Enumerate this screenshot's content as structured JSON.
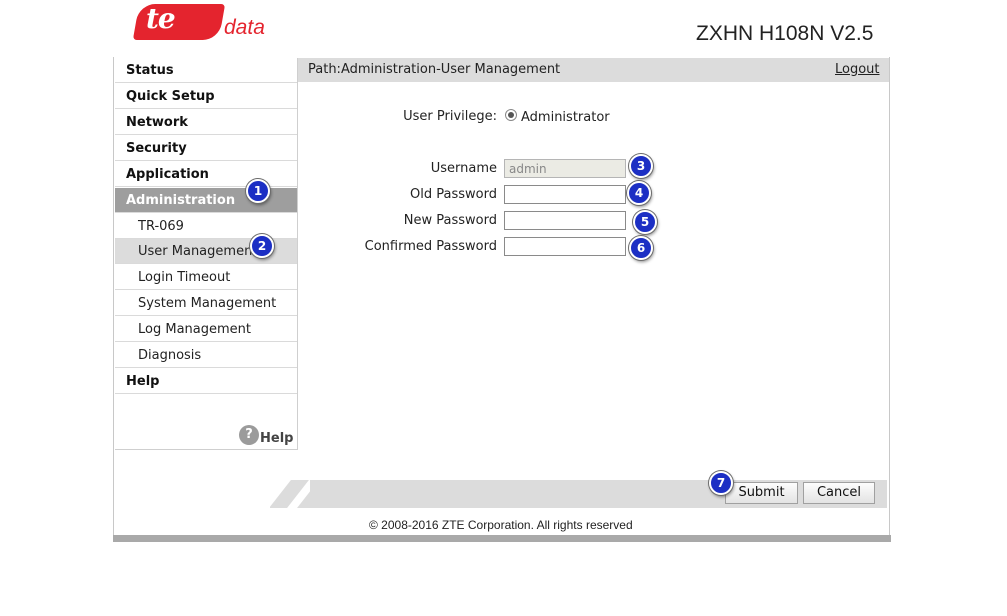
{
  "brand": {
    "logo_text": "te",
    "logo_suffix": "data",
    "model": "ZXHN H108N V2.5"
  },
  "sidebar": {
    "items": [
      {
        "label": "Status"
      },
      {
        "label": "Quick Setup"
      },
      {
        "label": "Network"
      },
      {
        "label": "Security"
      },
      {
        "label": "Application"
      },
      {
        "label": "Administration"
      },
      {
        "label": "TR-069"
      },
      {
        "label": "User Management"
      },
      {
        "label": "Login Timeout"
      },
      {
        "label": "System Management"
      },
      {
        "label": "Log Management"
      },
      {
        "label": "Diagnosis"
      },
      {
        "label": "Help"
      }
    ],
    "help_glyph": "?",
    "help_label": "Help"
  },
  "header": {
    "path": "Path:Administration-User Management",
    "logout": "Logout"
  },
  "form": {
    "privilege_label": "User Privilege:",
    "privilege_value": "Administrator",
    "username_label": "Username",
    "username_value": "admin",
    "old_password_label": "Old Password",
    "new_password_label": "New Password",
    "confirm_password_label": "Confirmed Password"
  },
  "markers": [
    "1",
    "2",
    "3",
    "4",
    "5",
    "6",
    "7"
  ],
  "buttons": {
    "submit": "Submit",
    "cancel": "Cancel"
  },
  "footer": {
    "copyright": "© 2008-2016 ZTE Corporation. All rights reserved"
  },
  "colors": {
    "brand_red": "#e4242e",
    "marker_blue": "#1c2fc4",
    "active_menu": "#9e9e9e",
    "bar_gray": "#dcdcdc"
  }
}
